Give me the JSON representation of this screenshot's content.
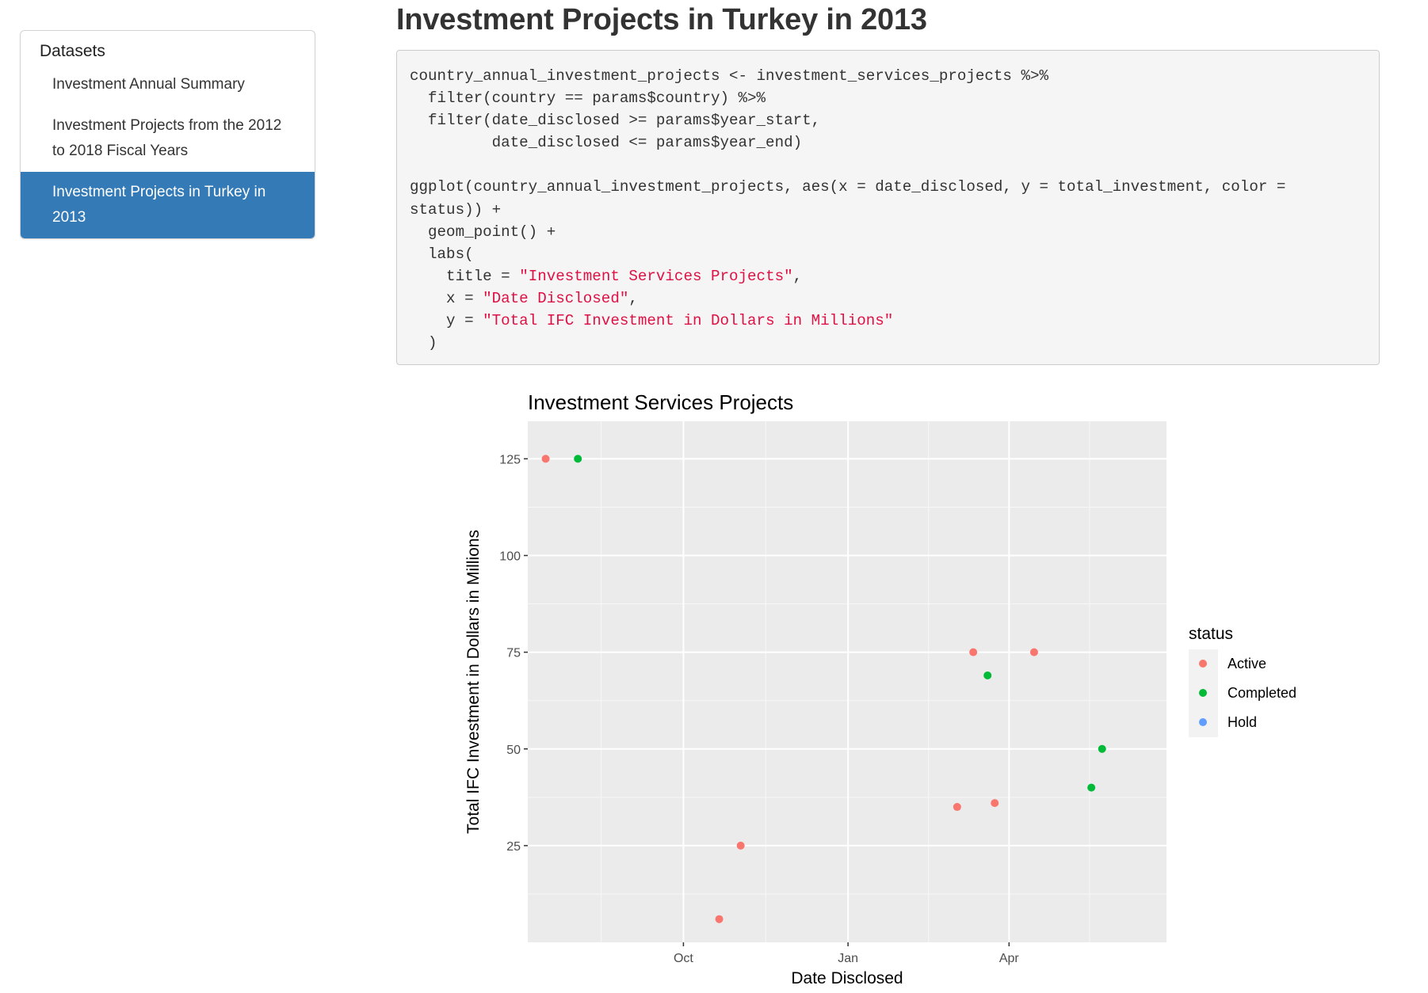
{
  "sidebar": {
    "header": "Datasets",
    "items": [
      {
        "label": "Investment Annual Summary",
        "active": false
      },
      {
        "label": "Investment Projects from the 2012 to 2018 Fiscal Years",
        "active": false
      },
      {
        "label": "Investment Projects in Turkey in 2013",
        "active": true
      }
    ]
  },
  "page": {
    "title": "Investment Projects in Turkey in 2013"
  },
  "code": {
    "lines": [
      [
        {
          "t": "country_annual_investment_projects <- investment_services_projects %>%"
        }
      ],
      [
        {
          "t": "  filter(country == params$country) %>%"
        }
      ],
      [
        {
          "t": "  filter(date_disclosed >= params$year_start,"
        }
      ],
      [
        {
          "t": "         date_disclosed <= params$year_end)"
        }
      ],
      [
        {
          "t": ""
        }
      ],
      [
        {
          "t": "ggplot(country_annual_investment_projects, aes(x = date_disclosed, y = total_investment, color ="
        }
      ],
      [
        {
          "t": "status)) +"
        }
      ],
      [
        {
          "t": "  geom_point() +"
        }
      ],
      [
        {
          "t": "  labs("
        }
      ],
      [
        {
          "t": "    title = "
        },
        {
          "t": "\"Investment Services Projects\"",
          "s": true
        },
        {
          "t": ","
        }
      ],
      [
        {
          "t": "    x = "
        },
        {
          "t": "\"Date Disclosed\"",
          "s": true
        },
        {
          "t": ","
        }
      ],
      [
        {
          "t": "    y = "
        },
        {
          "t": "\"Total IFC Investment in Dollars in Millions\"",
          "s": true
        }
      ],
      [
        {
          "t": "  )"
        }
      ]
    ]
  },
  "chart_data": {
    "type": "scatter",
    "title": "Investment Services Projects",
    "xlabel": "Date Disclosed",
    "ylabel": "Total IFC Investment in Dollars in Millions",
    "x_ticks": [
      {
        "date": "2013-10-01",
        "label": "Oct"
      },
      {
        "date": "2014-01-01",
        "label": "Jan"
      },
      {
        "date": "2014-04-01",
        "label": "Apr"
      }
    ],
    "x_range": [
      "2013-07-06",
      "2014-06-28"
    ],
    "y_ticks": [
      25,
      50,
      75,
      100,
      125
    ],
    "ylim": [
      0,
      134.7
    ],
    "grid": true,
    "legend": {
      "title": "status",
      "position": "right",
      "entries": [
        {
          "name": "Active",
          "color": "#F8766D"
        },
        {
          "name": "Completed",
          "color": "#00BA38"
        },
        {
          "name": "Hold",
          "color": "#619CFF"
        }
      ]
    },
    "points": [
      {
        "x": "2013-07-16",
        "y": 125,
        "status": "Active"
      },
      {
        "x": "2013-08-03",
        "y": 125,
        "status": "Completed"
      },
      {
        "x": "2013-10-21",
        "y": 6,
        "status": "Active"
      },
      {
        "x": "2013-11-02",
        "y": 25,
        "status": "Active"
      },
      {
        "x": "2014-03-03",
        "y": 35,
        "status": "Active"
      },
      {
        "x": "2014-03-12",
        "y": 75,
        "status": "Active"
      },
      {
        "x": "2014-03-20",
        "y": 69,
        "status": "Completed"
      },
      {
        "x": "2014-03-24",
        "y": 36,
        "status": "Active"
      },
      {
        "x": "2014-04-15",
        "y": 75,
        "status": "Active"
      },
      {
        "x": "2014-05-17",
        "y": 40,
        "status": "Completed"
      },
      {
        "x": "2014-05-23",
        "y": 50,
        "status": "Completed"
      }
    ]
  }
}
